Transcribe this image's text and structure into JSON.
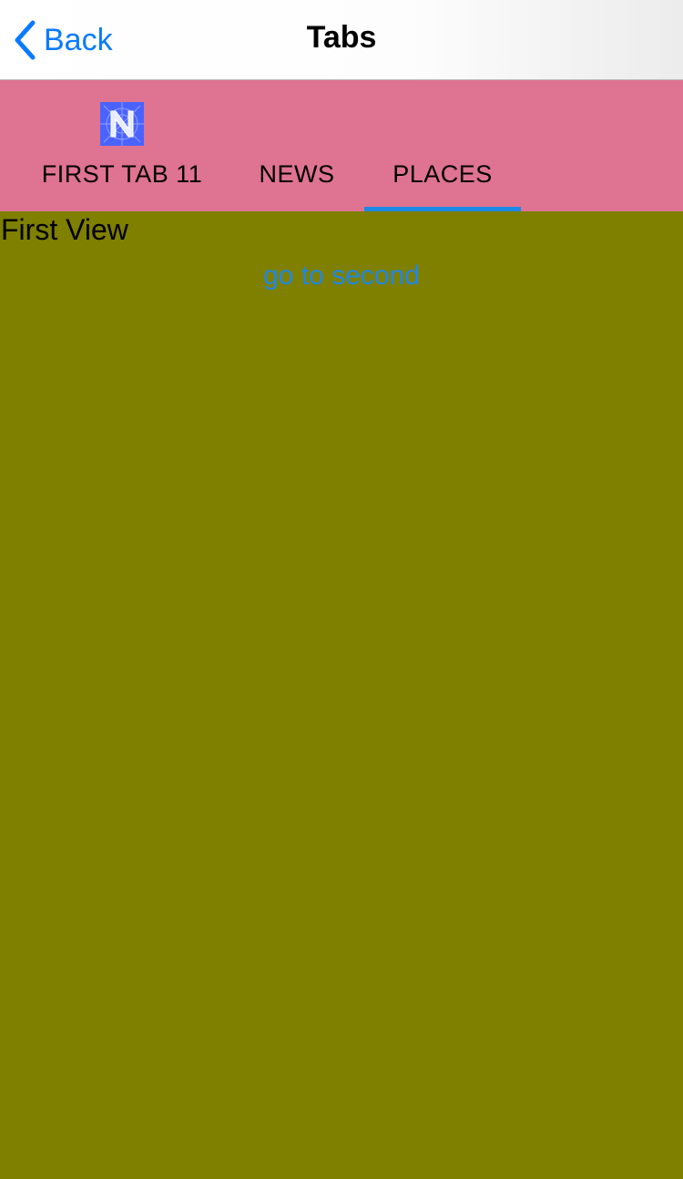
{
  "navbar": {
    "back_label": "Back",
    "title": "Tabs"
  },
  "tabs": [
    {
      "label": "FIRST TAB 11",
      "icon": "nativescript-logo-icon",
      "selected": false
    },
    {
      "label": "NEWS",
      "selected": false
    },
    {
      "label": "PLACES",
      "selected": true
    }
  ],
  "content": {
    "title": "First View",
    "link_label": "go to second"
  },
  "colors": {
    "tabstrip_bg": "#df7392",
    "content_bg": "#7f7f00",
    "accent": "#1e88e5",
    "ios_blue": "#0a7aff"
  }
}
